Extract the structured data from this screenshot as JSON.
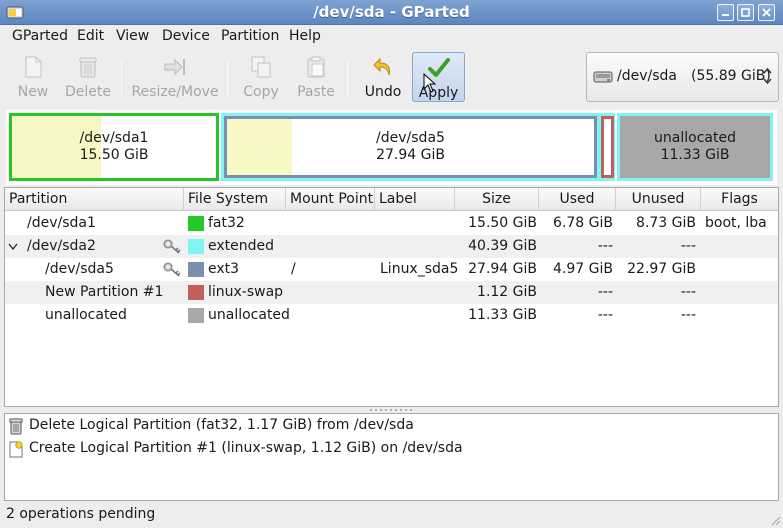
{
  "window": {
    "title": "/dev/sda - GParted"
  },
  "menu": [
    "GParted",
    "Edit",
    "View",
    "Device",
    "Partition",
    "Help"
  ],
  "toolbar": {
    "new": "New",
    "delete": "Delete",
    "resize_move": "Resize/Move",
    "copy": "Copy",
    "paste": "Paste",
    "undo": "Undo",
    "apply": "Apply"
  },
  "device_selector": {
    "device": "/dev/sda",
    "size": "(55.89 GiB)"
  },
  "map": [
    {
      "name": "/dev/sda1",
      "size": "15.50 GiB",
      "used_fraction": 0.437
    },
    {
      "name": "/dev/sda5",
      "size": "27.94 GiB",
      "used_fraction": 0.178
    },
    {
      "name": "unallocated",
      "size": "11.33 GiB"
    }
  ],
  "table": {
    "headers": [
      "Partition",
      "File System",
      "Mount Point",
      "Label",
      "Size",
      "Used",
      "Unused",
      "Flags"
    ],
    "rows": [
      {
        "partition": "/dev/sda1",
        "fs": "fat32",
        "fs_color": "#26c626",
        "mount": "",
        "label": "",
        "size": "15.50 GiB",
        "used": "6.78 GiB",
        "unused": "8.73 GiB",
        "flags": "boot, lba"
      },
      {
        "partition": "/dev/sda2",
        "fs": "extended",
        "fs_color": "#7ff4f4",
        "mount": "",
        "label": "",
        "size": "40.39 GiB",
        "used": "---",
        "unused": "---",
        "flags": ""
      },
      {
        "partition": "/dev/sda5",
        "fs": "ext3",
        "fs_color": "#7a8fb0",
        "mount": "/",
        "label": "Linux_sda5",
        "size": "27.94 GiB",
        "used": "4.97 GiB",
        "unused": "22.97 GiB",
        "flags": ""
      },
      {
        "partition": "New Partition #1",
        "fs": "linux-swap",
        "fs_color": "#c0605a",
        "mount": "",
        "label": "",
        "size": "1.12 GiB",
        "used": "---",
        "unused": "---",
        "flags": ""
      },
      {
        "partition": "unallocated",
        "fs": "unallocated",
        "fs_color": "#a8a8a8",
        "mount": "",
        "label": "",
        "size": "11.33 GiB",
        "used": "---",
        "unused": "---",
        "flags": ""
      }
    ]
  },
  "operations": [
    "Delete Logical Partition (fat32, 1.17 GiB) from /dev/sda",
    "Create Logical Partition #1 (linux-swap, 1.12 GiB) on /dev/sda"
  ],
  "status": "2 operations pending",
  "colors": {
    "fat32": "#26c626",
    "extended": "#7ff4f4",
    "ext3": "#7a8fb0",
    "linux_swap": "#c0605a",
    "unallocated": "#a8a8a8",
    "used": "#f8f8c4"
  }
}
